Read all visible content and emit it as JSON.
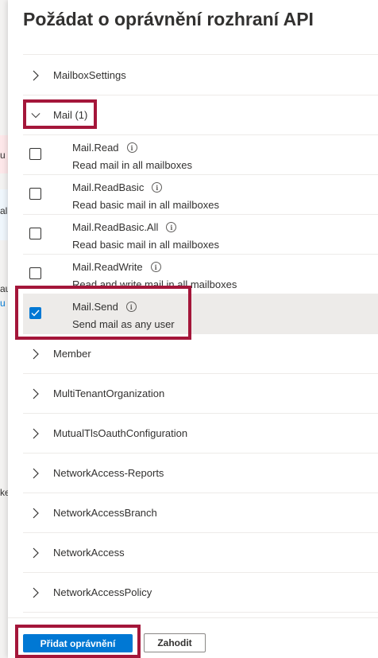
{
  "background": {
    "fragments": [
      "u",
      "ala",
      "u",
      "au",
      "ke"
    ]
  },
  "panel": {
    "title": "Požádat o oprávnění rozhraní API",
    "groups_before": [
      {
        "label": "MailboxSettings",
        "expanded": false
      }
    ],
    "mail_group": {
      "label": "Mail (1)",
      "expanded": true
    },
    "permissions": [
      {
        "name": "Mail.Read",
        "description": "Read mail in all mailboxes",
        "checked": false
      },
      {
        "name": "Mail.ReadBasic",
        "description": "Read basic mail in all mailboxes",
        "checked": false
      },
      {
        "name": "Mail.ReadBasic.All",
        "description": "Read basic mail in all mailboxes",
        "checked": false
      },
      {
        "name": "Mail.ReadWrite",
        "description": "Read and write mail in all mailboxes",
        "checked": false
      },
      {
        "name": "Mail.Send",
        "description": "Send mail as any user",
        "checked": true
      }
    ],
    "groups_after": [
      {
        "label": "Member"
      },
      {
        "label": "MultiTenantOrganization"
      },
      {
        "label": "MutualTlsOauthConfiguration"
      },
      {
        "label": "NetworkAccess-Reports"
      },
      {
        "label": "NetworkAccessBranch"
      },
      {
        "label": "NetworkAccess"
      },
      {
        "label": "NetworkAccessPolicy"
      }
    ]
  },
  "footer": {
    "add_label": "Přidat oprávnění",
    "discard_label": "Zahodit"
  },
  "colors": {
    "accent": "#0078d4",
    "highlight": "#a4163a"
  },
  "icons": {
    "chevron_collapsed": "chevron-right-icon",
    "chevron_expanded": "chevron-down-icon",
    "info": "info-icon",
    "check": "checkmark-icon"
  }
}
